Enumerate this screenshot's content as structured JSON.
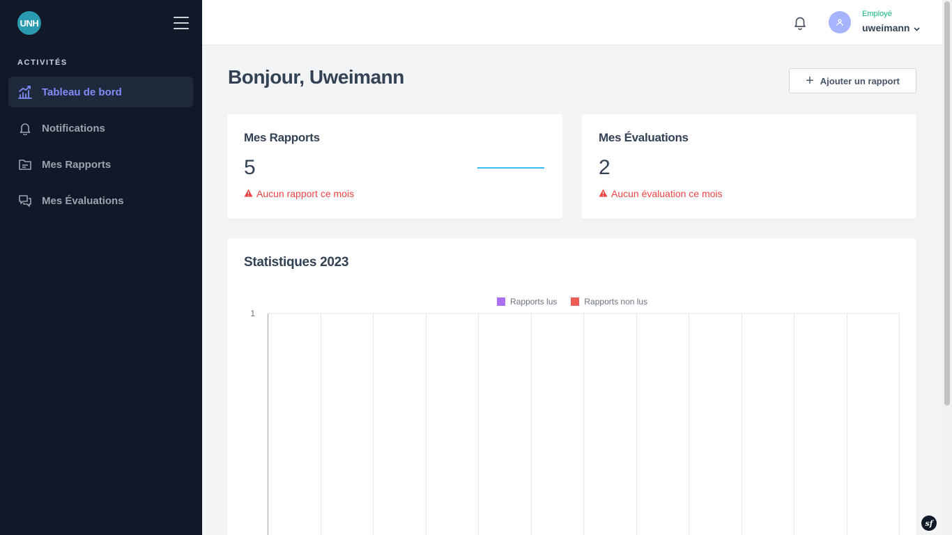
{
  "app": {
    "logo_text": "UNH"
  },
  "sidebar": {
    "section_title": "ACTIVITÉS",
    "items": [
      {
        "label": "Tableau de bord",
        "icon": "chart-bar-icon",
        "active": true
      },
      {
        "label": "Notifications",
        "icon": "bell-icon",
        "active": false
      },
      {
        "label": "Mes Rapports",
        "icon": "folder-icon",
        "active": false
      },
      {
        "label": "Mes Évaluations",
        "icon": "chat-icon",
        "active": false
      }
    ]
  },
  "header": {
    "user_role": "Employé",
    "username": "uweimann"
  },
  "main": {
    "greeting": "Bonjour, Uweimann",
    "add_report_label": "Ajouter un rapport",
    "cards": [
      {
        "title": "Mes Rapports",
        "value": "5",
        "warning": "Aucun rapport ce mois"
      },
      {
        "title": "Mes Évaluations",
        "value": "2",
        "warning": "Aucun évaluation ce mois"
      }
    ],
    "stats_title": "Statistiques 2023"
  },
  "colors": {
    "accent": "#818cf8",
    "sidebar_bg": "#111827",
    "warning": "#ef4444",
    "role": "#10b981",
    "series_read": "#a970f5",
    "series_unread": "#ef5b55"
  },
  "chart_data": {
    "type": "bar",
    "categories": [
      "",
      "",
      "",
      "",
      "",
      "",
      "",
      "",
      "",
      "",
      "",
      ""
    ],
    "series": [
      {
        "name": "Rapports lus",
        "color": "#a970f5",
        "values": [
          0,
          0,
          0,
          0,
          0,
          0,
          0,
          0,
          0,
          0,
          0,
          0
        ]
      },
      {
        "name": "Rapports non lus",
        "color": "#ef5b55",
        "values": [
          0,
          0,
          0,
          0,
          0,
          0,
          0,
          0,
          0,
          0,
          0,
          0
        ]
      }
    ],
    "y_ticks": [
      "1"
    ],
    "ylim": [
      0,
      1
    ],
    "grid": true,
    "legend": "top"
  }
}
